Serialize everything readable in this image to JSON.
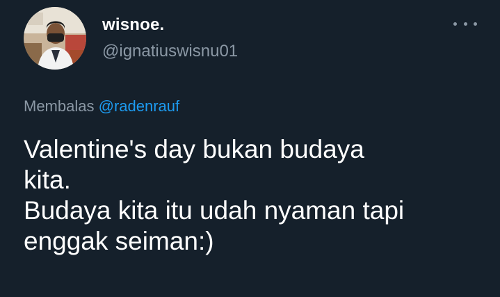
{
  "tweet": {
    "author": {
      "name": "wisnoe.",
      "handle": "@ignatiuswisnu01",
      "avatar": "profile-photo"
    },
    "more_icon": "more-horizontal-icon",
    "replying": {
      "prefix": "Membalas",
      "mention": "@radenrauf"
    },
    "text_lines": [
      "Valentine's day bukan budaya",
      "kita.",
      "Budaya kita itu udah nyaman tapi",
      "enggak seiman:)"
    ]
  },
  "colors": {
    "background": "#15202b",
    "primary_text": "#ffffff",
    "secondary_text": "#8b98a5",
    "accent": "#1d9bf0"
  }
}
